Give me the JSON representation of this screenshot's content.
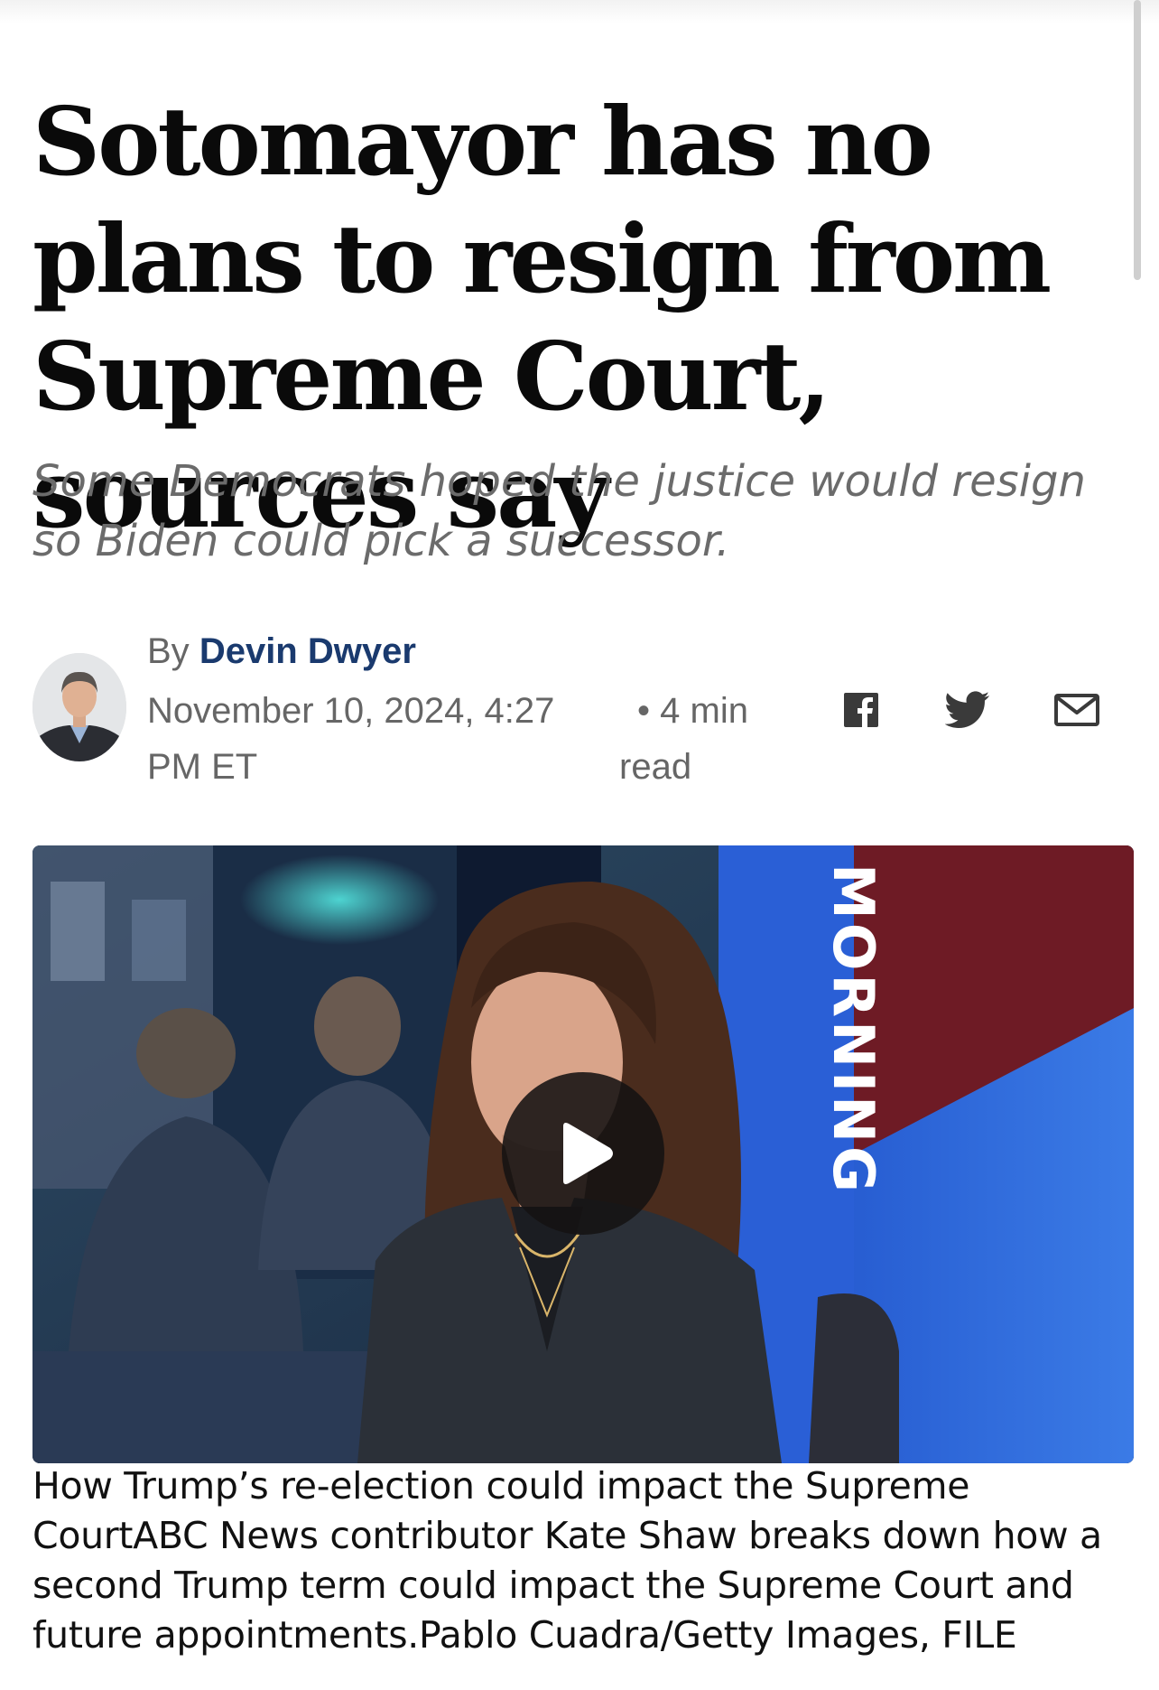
{
  "article": {
    "headline": "Sotomayor has no plans to resign from Supreme Court, sources say",
    "dek": "Some Democrats hoped the justice would resign so Biden could pick a successor.",
    "byline_prefix": "By",
    "author": "Devin Dwyer",
    "date": "November 10, 2024, 4:27 PM ET",
    "read_time": "4 min read",
    "read_time_bullet": "•"
  },
  "share": {
    "icons": [
      "facebook-icon",
      "twitter-icon",
      "email-icon"
    ]
  },
  "video": {
    "icon": "play-icon",
    "frame_text": "MORNING",
    "caption": "How Trump’s re-election could impact the Supreme CourtABC News contributor Kate Shaw breaks down how a second Trump term could impact the Supreme Court and future appointments.Pablo Cuadra/Getty Images, FILE"
  },
  "colors": {
    "author_link": "#1a3a6e",
    "dek_gray": "#6b6b6b",
    "meta_gray": "#666666",
    "play_button_bg": "#141212"
  }
}
